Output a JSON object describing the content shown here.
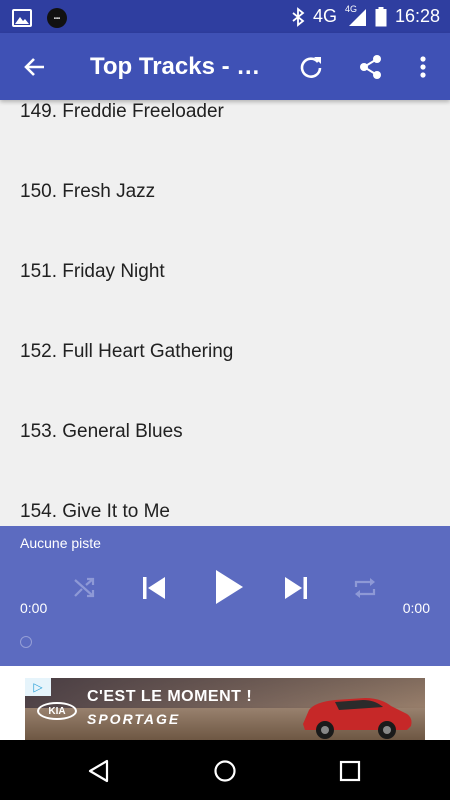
{
  "status_bar": {
    "time": "16:28",
    "network": "4G",
    "network_small": "4G",
    "icons": [
      "image-icon",
      "app-badge-icon",
      "bluetooth-icon",
      "signal-icon",
      "battery-icon"
    ]
  },
  "app_bar": {
    "title": "Top Tracks - S...",
    "icons": [
      "back-arrow-icon",
      "refresh-icon",
      "share-icon",
      "more-vert-icon"
    ]
  },
  "tracks": [
    "149. Freddie Freeloader",
    "150. Fresh Jazz",
    "151. Friday Night",
    "152. Full Heart Gathering",
    "153. General Blues",
    "154. Give It to Me"
  ],
  "player": {
    "track_label": "Aucune piste",
    "time_elapsed": "0:00",
    "time_total": "0:00",
    "progress": 0,
    "controls": [
      "shuffle-icon",
      "previous-icon",
      "play-icon",
      "next-icon",
      "repeat-icon"
    ]
  },
  "ad": {
    "brand": "KIA",
    "headline": "C'EST LE MOMENT !",
    "subline": "SPORTAGE"
  },
  "nav_bar": {
    "icons": [
      "back-triangle-icon",
      "home-circle-icon",
      "recents-square-icon"
    ]
  },
  "colors": {
    "status_bar": "#2f3ea0",
    "app_bar": "#3f51b5",
    "player": "#5c6bc0",
    "list_bg": "#f0f0f0"
  }
}
